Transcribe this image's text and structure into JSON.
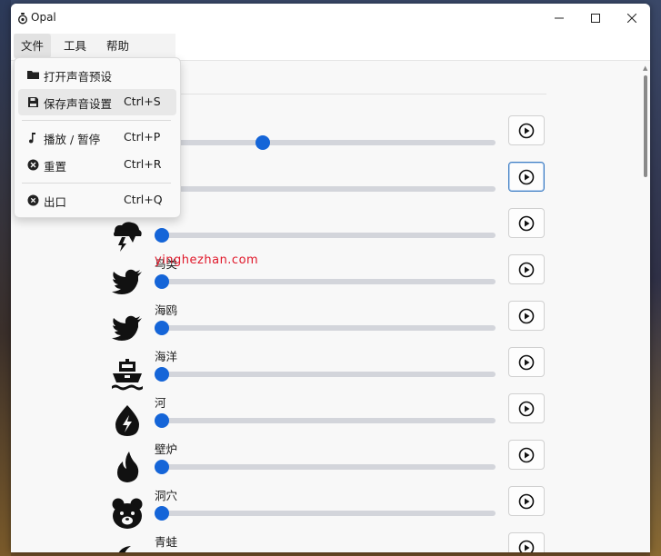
{
  "window": {
    "title": "Opal"
  },
  "menubar": {
    "file": "文件",
    "tools": "工具",
    "help": "帮助"
  },
  "file_menu": {
    "items": [
      {
        "label": "打开声音预设",
        "shortcut": "",
        "icon": "folder-icon"
      },
      {
        "label": "保存声音设置",
        "shortcut": "Ctrl+S",
        "icon": "save-icon"
      },
      {
        "label": "播放 / 暂停",
        "shortcut": "Ctrl+P",
        "icon": "music-note-icon"
      },
      {
        "label": "重置",
        "shortcut": "Ctrl+R",
        "icon": "reset-icon"
      },
      {
        "label": "出口",
        "shortcut": "Ctrl+Q",
        "icon": "exit-icon"
      }
    ]
  },
  "sounds": [
    {
      "label": "",
      "icon": "",
      "volume": 0.31
    },
    {
      "label": "",
      "icon": "",
      "volume": 0.0
    },
    {
      "label": "",
      "icon": "storm-icon",
      "volume": 0.0
    },
    {
      "label": "鸟类",
      "icon": "bird-icon",
      "volume": 0.0
    },
    {
      "label": "海鸥",
      "icon": "bird-icon",
      "volume": 0.0
    },
    {
      "label": "海洋",
      "icon": "ship-icon",
      "volume": 0.0
    },
    {
      "label": "河",
      "icon": "water-drop-icon",
      "volume": 0.0
    },
    {
      "label": "壁炉",
      "icon": "fire-icon",
      "volume": 0.0
    },
    {
      "label": "洞穴",
      "icon": "bear-icon",
      "volume": 0.0
    },
    {
      "label": "青蛙",
      "icon": "moon-icon",
      "volume": 0.0
    }
  ],
  "watermark": "yinghezhan.com",
  "colors": {
    "accent": "#1565d8",
    "track": "#d3d5db",
    "watermark": "#e0182a"
  }
}
